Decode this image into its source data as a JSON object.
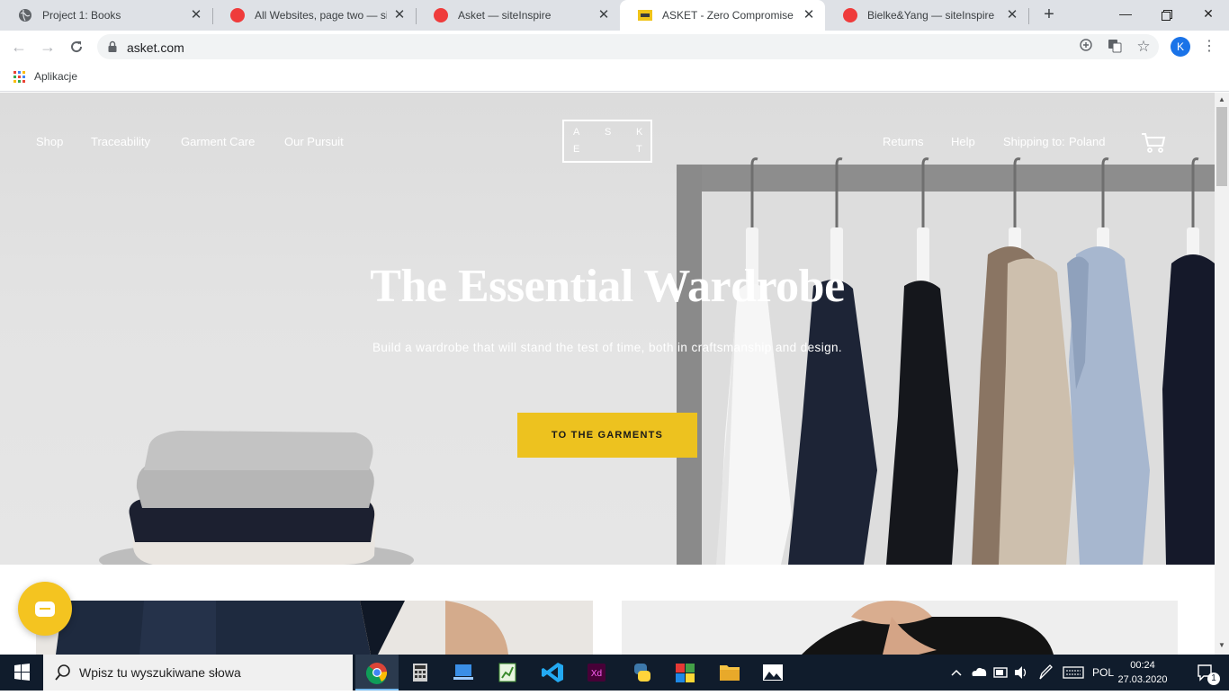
{
  "browser": {
    "tabs": [
      {
        "title": "Project 1: Books",
        "favicon": "globe-icon",
        "color": "#5f6368",
        "active": false
      },
      {
        "title": "All Websites, page two — siteInspire",
        "favicon": "siteinspire-icon",
        "color": "#ef3b3b",
        "active": false
      },
      {
        "title": "Asket — siteInspire",
        "favicon": "siteinspire-icon",
        "color": "#ef3b3b",
        "active": false
      },
      {
        "title": "ASKET - Zero Compromise Garments",
        "favicon": "asket-icon",
        "color": "#f0c419",
        "active": true
      },
      {
        "title": "Bielke&Yang — siteInspire",
        "favicon": "siteinspire-icon",
        "color": "#ef3b3b",
        "active": false
      }
    ],
    "new_tab_label": "+",
    "url": "asket.com",
    "profile_initial": "K",
    "bookmarks": {
      "apps_label": "Aplikacje"
    }
  },
  "site": {
    "nav_left": [
      "Shop",
      "Traceability",
      "Garment Care",
      "Our Pursuit"
    ],
    "logo_letters": {
      "a": "A",
      "s": "S",
      "k": "K",
      "e": "E",
      "t": "T"
    },
    "nav_right": {
      "returns": "Returns",
      "help": "Help",
      "shipping_prefix": "Shipping to:",
      "shipping_country": "Poland"
    },
    "hero": {
      "title": "The Essential Wardrobe",
      "subtitle": "Build a wardrobe that will stand the test of time, both in craftsmanship and design.",
      "cta": "TO THE GARMENTS"
    },
    "colors": {
      "accent": "#edc21f",
      "chat": "#f4c420"
    }
  },
  "taskbar": {
    "search_placeholder": "Wpisz tu wyszukiwane słowa",
    "language": "POL",
    "time": "00:24",
    "date": "27.03.2020",
    "notifications": "1"
  }
}
